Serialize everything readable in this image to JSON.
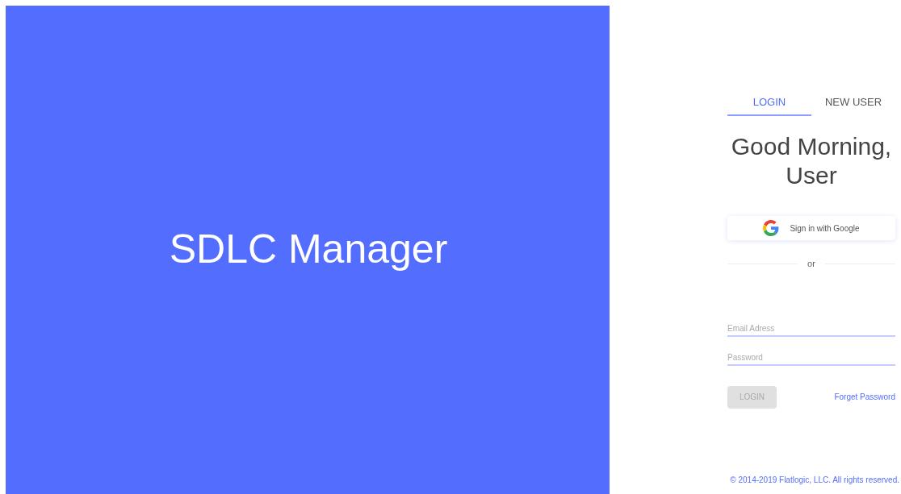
{
  "brand": {
    "title": "SDLC Manager"
  },
  "tabs": [
    {
      "label": "LOGIN",
      "selected": true
    },
    {
      "label": "NEW USER",
      "selected": false
    }
  ],
  "greeting": "Good Morning, User",
  "google_button": "Sign in with Google",
  "divider": "or",
  "fields": [
    {
      "placeholder": "Email Adress"
    },
    {
      "placeholder": "Password"
    }
  ],
  "login_button": {
    "label": "LOGIN",
    "disabled": true
  },
  "forgot_link": "Forget Password",
  "footer": "© 2014-2019 Flatlogic, LLC. All rights reserved."
}
